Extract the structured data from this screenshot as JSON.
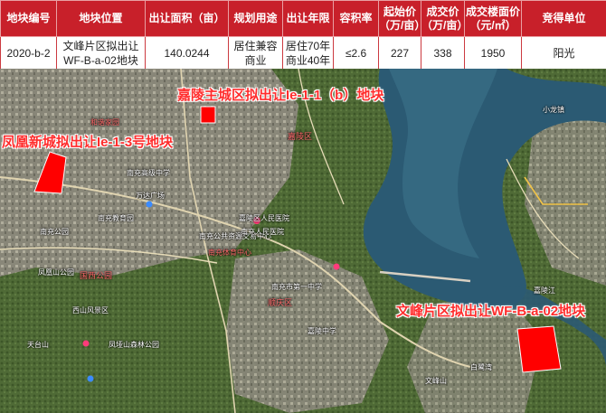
{
  "table": {
    "headers": {
      "plot_id": "地块编号",
      "location": "地块位置",
      "area": "出让面积（亩）",
      "usage": "规划用途",
      "term": "出让年限",
      "far": "容积率",
      "start_price": "起始价（万/亩）",
      "deal_price": "成交价（万/亩）",
      "floor_price": "成交楼面价（元/㎡）",
      "winner": "竞得单位"
    },
    "row": {
      "plot_id": "2020-b-2",
      "location": "文峰片区拟出让WF-B-a-02地块",
      "area": "140.0244",
      "usage": "居住兼容商业",
      "term": "居住70年商业40年",
      "far": "≤2.6",
      "start_price": "227",
      "deal_price": "338",
      "floor_price": "1950",
      "winner": "阳光"
    }
  },
  "map": {
    "plot_labels": {
      "jialing": "嘉陵主城区拟出让Ie-1-1（b）地块",
      "fenghuang": "凤凰新城拟出让Ie-1-3号地块",
      "wenfeng": "文峰片区拟出让WF-B-a-02地块"
    },
    "pois": [
      {
        "id": "hexie",
        "text": "和谐家园"
      },
      {
        "id": "nanchong-gaozhong",
        "text": "南充高级中学"
      },
      {
        "id": "nanchong-jiaoyuan",
        "text": "南充教育园"
      },
      {
        "id": "nanchong-gonggongziyuan",
        "text": "南充公共资源交易中心"
      },
      {
        "id": "jialing-renmin",
        "text": "嘉陵区人民医院"
      },
      {
        "id": "nanchong-tiyu",
        "text": "南充体育中心"
      },
      {
        "id": "wanda",
        "text": "万达广场"
      },
      {
        "id": "nanchong-gongyuan",
        "text": "南充公园"
      },
      {
        "id": "fenghuangshan",
        "text": "凤凰山公园"
      },
      {
        "id": "guoxi",
        "text": "国西公园"
      },
      {
        "id": "xishan",
        "text": "西山风景区"
      },
      {
        "id": "jialingjiang",
        "text": "嘉陵江"
      },
      {
        "id": "nanchongren",
        "text": "南充人民医院"
      },
      {
        "id": "tiantai",
        "text": "天台山"
      },
      {
        "id": "ji-county",
        "text": "嘉陵区"
      },
      {
        "id": "xiaolong",
        "text": "小龙镇"
      },
      {
        "id": "wenfeng-shi",
        "text": "文峰山"
      },
      {
        "id": "yuandayi",
        "text": "南充市第一中学"
      },
      {
        "id": "jiazhuang",
        "text": "嘉陵中学"
      },
      {
        "id": "shuncheng",
        "text": "顺庆区"
      },
      {
        "id": "bailu",
        "text": "白鹭湾"
      },
      {
        "id": "fengshui",
        "text": "凤垭山森林公园"
      }
    ]
  },
  "colors": {
    "header_bg": "#c8202a",
    "plot_fill": "#ff0000",
    "label_color": "#ff2c2c"
  }
}
